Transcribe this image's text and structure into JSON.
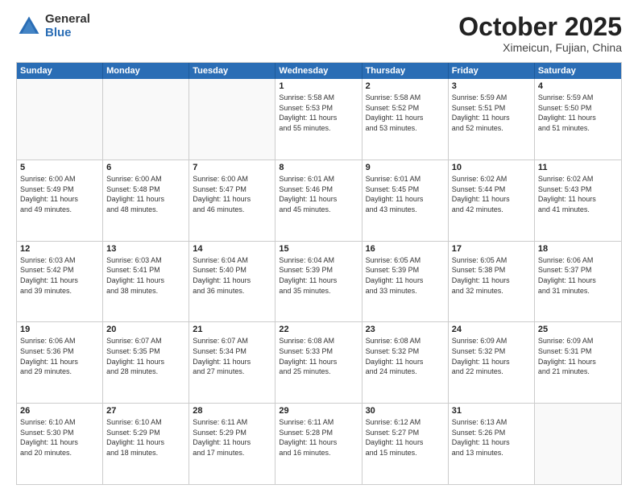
{
  "header": {
    "logo": {
      "general": "General",
      "blue": "Blue"
    },
    "title": "October 2025",
    "subtitle": "Ximeicun, Fujian, China"
  },
  "weekdays": [
    "Sunday",
    "Monday",
    "Tuesday",
    "Wednesday",
    "Thursday",
    "Friday",
    "Saturday"
  ],
  "weeks": [
    [
      {
        "day": "",
        "info": ""
      },
      {
        "day": "",
        "info": ""
      },
      {
        "day": "",
        "info": ""
      },
      {
        "day": "1",
        "info": "Sunrise: 5:58 AM\nSunset: 5:53 PM\nDaylight: 11 hours\nand 55 minutes."
      },
      {
        "day": "2",
        "info": "Sunrise: 5:58 AM\nSunset: 5:52 PM\nDaylight: 11 hours\nand 53 minutes."
      },
      {
        "day": "3",
        "info": "Sunrise: 5:59 AM\nSunset: 5:51 PM\nDaylight: 11 hours\nand 52 minutes."
      },
      {
        "day": "4",
        "info": "Sunrise: 5:59 AM\nSunset: 5:50 PM\nDaylight: 11 hours\nand 51 minutes."
      }
    ],
    [
      {
        "day": "5",
        "info": "Sunrise: 6:00 AM\nSunset: 5:49 PM\nDaylight: 11 hours\nand 49 minutes."
      },
      {
        "day": "6",
        "info": "Sunrise: 6:00 AM\nSunset: 5:48 PM\nDaylight: 11 hours\nand 48 minutes."
      },
      {
        "day": "7",
        "info": "Sunrise: 6:00 AM\nSunset: 5:47 PM\nDaylight: 11 hours\nand 46 minutes."
      },
      {
        "day": "8",
        "info": "Sunrise: 6:01 AM\nSunset: 5:46 PM\nDaylight: 11 hours\nand 45 minutes."
      },
      {
        "day": "9",
        "info": "Sunrise: 6:01 AM\nSunset: 5:45 PM\nDaylight: 11 hours\nand 43 minutes."
      },
      {
        "day": "10",
        "info": "Sunrise: 6:02 AM\nSunset: 5:44 PM\nDaylight: 11 hours\nand 42 minutes."
      },
      {
        "day": "11",
        "info": "Sunrise: 6:02 AM\nSunset: 5:43 PM\nDaylight: 11 hours\nand 41 minutes."
      }
    ],
    [
      {
        "day": "12",
        "info": "Sunrise: 6:03 AM\nSunset: 5:42 PM\nDaylight: 11 hours\nand 39 minutes."
      },
      {
        "day": "13",
        "info": "Sunrise: 6:03 AM\nSunset: 5:41 PM\nDaylight: 11 hours\nand 38 minutes."
      },
      {
        "day": "14",
        "info": "Sunrise: 6:04 AM\nSunset: 5:40 PM\nDaylight: 11 hours\nand 36 minutes."
      },
      {
        "day": "15",
        "info": "Sunrise: 6:04 AM\nSunset: 5:39 PM\nDaylight: 11 hours\nand 35 minutes."
      },
      {
        "day": "16",
        "info": "Sunrise: 6:05 AM\nSunset: 5:39 PM\nDaylight: 11 hours\nand 33 minutes."
      },
      {
        "day": "17",
        "info": "Sunrise: 6:05 AM\nSunset: 5:38 PM\nDaylight: 11 hours\nand 32 minutes."
      },
      {
        "day": "18",
        "info": "Sunrise: 6:06 AM\nSunset: 5:37 PM\nDaylight: 11 hours\nand 31 minutes."
      }
    ],
    [
      {
        "day": "19",
        "info": "Sunrise: 6:06 AM\nSunset: 5:36 PM\nDaylight: 11 hours\nand 29 minutes."
      },
      {
        "day": "20",
        "info": "Sunrise: 6:07 AM\nSunset: 5:35 PM\nDaylight: 11 hours\nand 28 minutes."
      },
      {
        "day": "21",
        "info": "Sunrise: 6:07 AM\nSunset: 5:34 PM\nDaylight: 11 hours\nand 27 minutes."
      },
      {
        "day": "22",
        "info": "Sunrise: 6:08 AM\nSunset: 5:33 PM\nDaylight: 11 hours\nand 25 minutes."
      },
      {
        "day": "23",
        "info": "Sunrise: 6:08 AM\nSunset: 5:32 PM\nDaylight: 11 hours\nand 24 minutes."
      },
      {
        "day": "24",
        "info": "Sunrise: 6:09 AM\nSunset: 5:32 PM\nDaylight: 11 hours\nand 22 minutes."
      },
      {
        "day": "25",
        "info": "Sunrise: 6:09 AM\nSunset: 5:31 PM\nDaylight: 11 hours\nand 21 minutes."
      }
    ],
    [
      {
        "day": "26",
        "info": "Sunrise: 6:10 AM\nSunset: 5:30 PM\nDaylight: 11 hours\nand 20 minutes."
      },
      {
        "day": "27",
        "info": "Sunrise: 6:10 AM\nSunset: 5:29 PM\nDaylight: 11 hours\nand 18 minutes."
      },
      {
        "day": "28",
        "info": "Sunrise: 6:11 AM\nSunset: 5:29 PM\nDaylight: 11 hours\nand 17 minutes."
      },
      {
        "day": "29",
        "info": "Sunrise: 6:11 AM\nSunset: 5:28 PM\nDaylight: 11 hours\nand 16 minutes."
      },
      {
        "day": "30",
        "info": "Sunrise: 6:12 AM\nSunset: 5:27 PM\nDaylight: 11 hours\nand 15 minutes."
      },
      {
        "day": "31",
        "info": "Sunrise: 6:13 AM\nSunset: 5:26 PM\nDaylight: 11 hours\nand 13 minutes."
      },
      {
        "day": "",
        "info": ""
      }
    ]
  ]
}
